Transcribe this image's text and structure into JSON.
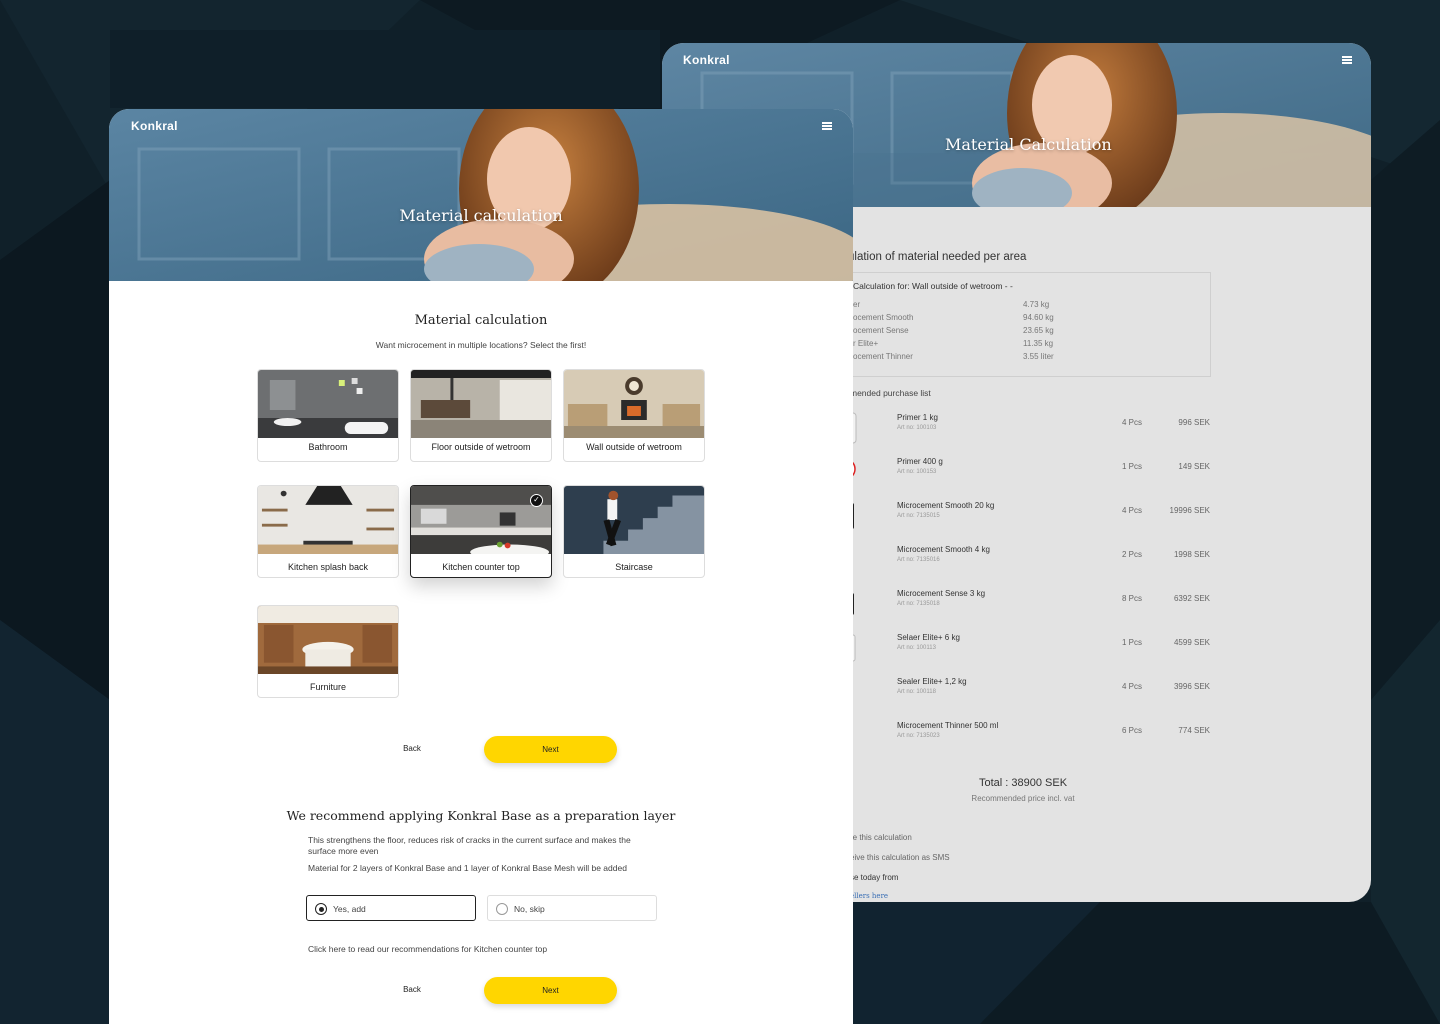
{
  "back_card": {
    "logo": "Konkral",
    "hero_title": "Material Calculation",
    "heading": "ulation of material needed per area",
    "calc_title": "Calculation for: Wall outside of wetroom - -",
    "calc_rows": [
      {
        "name": "er",
        "value": "4.73 kg"
      },
      {
        "name": "ocement Smooth",
        "value": "94.60 kg"
      },
      {
        "name": "ocement Sense",
        "value": "23.65 kg"
      },
      {
        "name": "r Elite+",
        "value": "11.35 kg"
      },
      {
        "name": "ocement Thinner",
        "value": "3.55 liter"
      }
    ],
    "purchase_title": "mended purchase list",
    "products": [
      {
        "name": "Primer 1 kg",
        "art": "Art no: 100103",
        "qty": "4 Pcs",
        "price": "996 SEK"
      },
      {
        "name": "Primer 400 g",
        "art": "Art no: 100153",
        "qty": "1 Pcs",
        "price": "149 SEK"
      },
      {
        "name": "Microcement Smooth 20 kg",
        "art": "Art no: 7135015",
        "qty": "4 Pcs",
        "price": "19996 SEK"
      },
      {
        "name": "Microcement Smooth 4 kg",
        "art": "Art no: 7135016",
        "qty": "2 Pcs",
        "price": "1998 SEK"
      },
      {
        "name": "Microcement Sense 3 kg",
        "art": "Art no: 7135018",
        "qty": "8 Pcs",
        "price": "6392 SEK"
      },
      {
        "name": "Selaer Elite+ 6 kg",
        "art": "Art no: 100113",
        "qty": "1 Pcs",
        "price": "4599 SEK"
      },
      {
        "name": "Sealer Elite+ 1,2 kg",
        "art": "Art no: 100118",
        "qty": "4 Pcs",
        "price": "3996 SEK"
      },
      {
        "name": "Microcement Thinner 500 ml",
        "art": "Art no: 7135023",
        "qty": "6 Pcs",
        "price": "774 SEK"
      }
    ],
    "total": "Total : 38900 SEK",
    "total_sub": "Recommended price incl. vat",
    "share": "re this calculation",
    "sms": "eive this calculation as SMS",
    "buy": "se today from",
    "resellers": "ellers here"
  },
  "front_card": {
    "logo": "Konkral",
    "hero_title": "Material calculation",
    "title": "Material calculation",
    "subtitle": "Want microcement in multiple locations? Select the first!",
    "tiles": [
      {
        "label": "Bathroom"
      },
      {
        "label": "Floor outside of wetroom"
      },
      {
        "label": "Wall outside of wetroom"
      },
      {
        "label": "Kitchen splash back"
      },
      {
        "label": "Kitchen counter top",
        "selected": true
      },
      {
        "label": "Staircase"
      },
      {
        "label": "Furniture"
      }
    ],
    "back_label": "Back",
    "next_label": "Next",
    "rec_title": "We recommend applying Konkral Base as a preparation layer",
    "rec_p1": "This strengthens the floor, reduces risk of cracks in the current surface and makes the surface more even",
    "rec_p2": "Material for 2 layers of Konkral Base and 1 layer of Konkral Base Mesh will be added",
    "option_yes": "Yes, add",
    "option_no": "No, skip",
    "rec_link": "Click here to read our recommendations for Kitchen counter top"
  },
  "colors": {
    "accent": "#ffd600",
    "background": "#0f1d26"
  }
}
